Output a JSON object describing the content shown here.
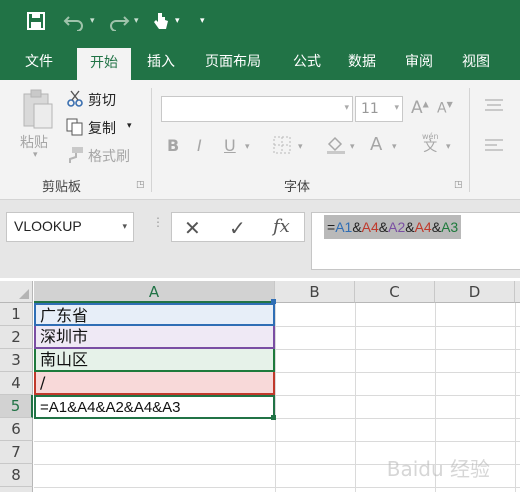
{
  "quick_access": {
    "save_icon": "save-icon",
    "undo_icon": "undo-icon",
    "redo_icon": "redo-icon",
    "touch_icon": "touch-mode-icon",
    "customize_icon": "customize-qat-icon"
  },
  "tabs": [
    {
      "label": "文件"
    },
    {
      "label": "开始",
      "active": true
    },
    {
      "label": "插入"
    },
    {
      "label": "页面布局"
    },
    {
      "label": "公式"
    },
    {
      "label": "数据"
    },
    {
      "label": "审阅"
    },
    {
      "label": "视图"
    }
  ],
  "ribbon": {
    "clipboard": {
      "paste_label": "粘贴",
      "cut_label": "剪切",
      "copy_label": "复制",
      "format_painter_label": "格式刷",
      "group_label": "剪贴板"
    },
    "font": {
      "font_name": "",
      "font_size": "11",
      "bold": "B",
      "italic": "I",
      "underline": "U",
      "grow_font": "A",
      "shrink_font": "A",
      "font_color": "A",
      "phonetic": "wén",
      "phonetic_char": "文",
      "group_label": "字体"
    }
  },
  "formula_bar": {
    "name_box": "VLOOKUP",
    "cancel_symbol": "✕",
    "enter_symbol": "✓",
    "fx_label": "fx",
    "formula_parts": [
      {
        "text": "=",
        "color": "#222222"
      },
      {
        "text": "A1",
        "color": "#2f6eb5"
      },
      {
        "text": "&",
        "color": "#222222"
      },
      {
        "text": "A4",
        "color": "#c0392b"
      },
      {
        "text": "&",
        "color": "#222222"
      },
      {
        "text": "A2",
        "color": "#7a4ea3"
      },
      {
        "text": "&",
        "color": "#222222"
      },
      {
        "text": "A4",
        "color": "#c0392b"
      },
      {
        "text": "&",
        "color": "#222222"
      },
      {
        "text": "A3",
        "color": "#1e7a3c"
      }
    ]
  },
  "sheet": {
    "columns": [
      "A",
      "B",
      "C",
      "D"
    ],
    "rows": [
      "1",
      "2",
      "3",
      "4",
      "5",
      "6",
      "7",
      "8"
    ],
    "cells": {
      "A1": "广东省",
      "A2": "深圳市",
      "A3": "南山区",
      "A4": "/",
      "A5": "=A1&A4&A2&A4&A3"
    },
    "highlight_colors": {
      "A1": "#2f6eb5",
      "A2": "#7a4ea3",
      "A3": "#1e7a3c",
      "A4": "#c0392b"
    }
  },
  "watermark": "Baidu 经验"
}
